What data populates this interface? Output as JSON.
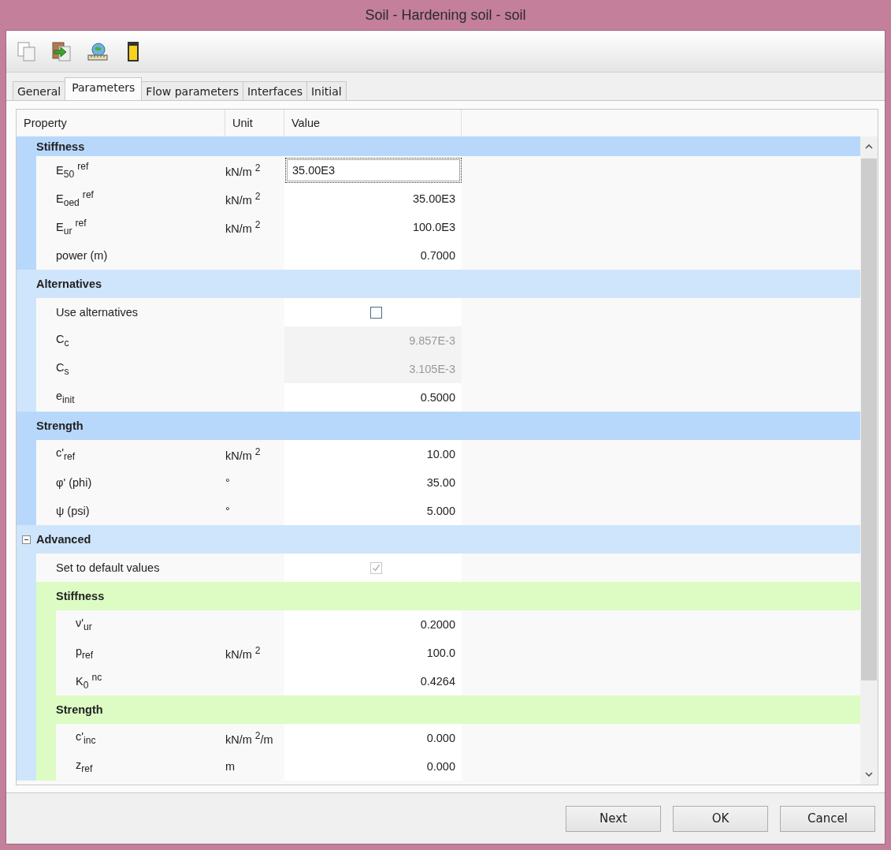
{
  "window": {
    "title": "Soil - Hardening soil - soil"
  },
  "tabs": [
    {
      "label": "General",
      "selected": false
    },
    {
      "label": "Parameters",
      "selected": true
    },
    {
      "label": "Flow parameters",
      "selected": false
    },
    {
      "label": "Interfaces",
      "selected": false
    },
    {
      "label": "Initial",
      "selected": false
    }
  ],
  "columns": [
    "Property",
    "Unit",
    "Value"
  ],
  "groups": [
    {
      "title": "Stiffness",
      "rows": [
        {
          "kind": "value",
          "property": "E$_{50}$ $^{ref}$",
          "unit": "kN/m $^{2}$",
          "value": "35.00E3",
          "disabled": false,
          "editing": true
        },
        {
          "kind": "value",
          "property": "E$_{oed}$ $^{ref}$",
          "unit": "kN/m $^{2}$",
          "value": "35.00E3",
          "disabled": false,
          "editing": false
        },
        {
          "kind": "value",
          "property": "E$_{ur}$ $^{ref}$",
          "unit": "kN/m $^{2}$",
          "value": "100.0E3",
          "disabled": false,
          "editing": false
        },
        {
          "kind": "value",
          "property": "power (m)",
          "value": "0.7000",
          "disabled": false,
          "editing": false
        }
      ]
    },
    {
      "title": "Alternatives",
      "rows": [
        {
          "kind": "checkbox",
          "property": "Use alternatives",
          "checked": false,
          "disabled": false
        },
        {
          "kind": "value",
          "property": "C$_{c}$",
          "value": "9.857E-3",
          "disabled": true,
          "editing": false
        },
        {
          "kind": "value",
          "property": "C$_{s}$",
          "value": "3.105E-3",
          "disabled": true,
          "editing": false
        },
        {
          "kind": "value",
          "property": "e$_{init}$",
          "value": "0.5000",
          "disabled": false,
          "editing": false
        }
      ]
    },
    {
      "title": "Strength",
      "rows": [
        {
          "kind": "value",
          "property": "c'$_{ref}$",
          "unit": "kN/m $^{2}$",
          "value": "10.00",
          "disabled": false,
          "editing": false
        },
        {
          "kind": "value",
          "property": "φ' (phi)",
          "unit": "°",
          "value": "35.00",
          "disabled": false,
          "editing": false
        },
        {
          "kind": "value",
          "property": "ψ (psi)",
          "unit": "°",
          "value": "5.000",
          "disabled": false,
          "editing": false
        }
      ]
    },
    {
      "title": "Advanced",
      "expanded": true,
      "rows": [
        {
          "kind": "checkbox",
          "property": "Set to default values",
          "checked": true,
          "disabled": true
        }
      ],
      "groups": [
        {
          "title": "Stiffness",
          "rows": [
            {
              "kind": "value",
              "property": "ν'$_{ur}$",
              "value": "0.2000",
              "disabled": false,
              "editing": false
            },
            {
              "kind": "value",
              "property": "p$_{ref}$",
              "unit": "kN/m $^{2}$",
              "value": "100.0",
              "disabled": false,
              "editing": false
            },
            {
              "kind": "value",
              "property": "K$_{0}$ $^{nc}$",
              "value": "0.4264",
              "disabled": false,
              "editing": false
            }
          ]
        },
        {
          "title": "Strength",
          "rows": [
            {
              "kind": "value",
              "property": "c'$_{inc}$",
              "unit": "kN/m $^{2}$/m",
              "value": "0.000",
              "disabled": false,
              "editing": false
            },
            {
              "kind": "value",
              "property": "z$_{ref}$",
              "unit": "m",
              "value": "0.000",
              "disabled": false,
              "editing": false
            }
          ]
        }
      ]
    }
  ],
  "buttons": [
    "Next",
    "OK",
    "Cancel"
  ]
}
